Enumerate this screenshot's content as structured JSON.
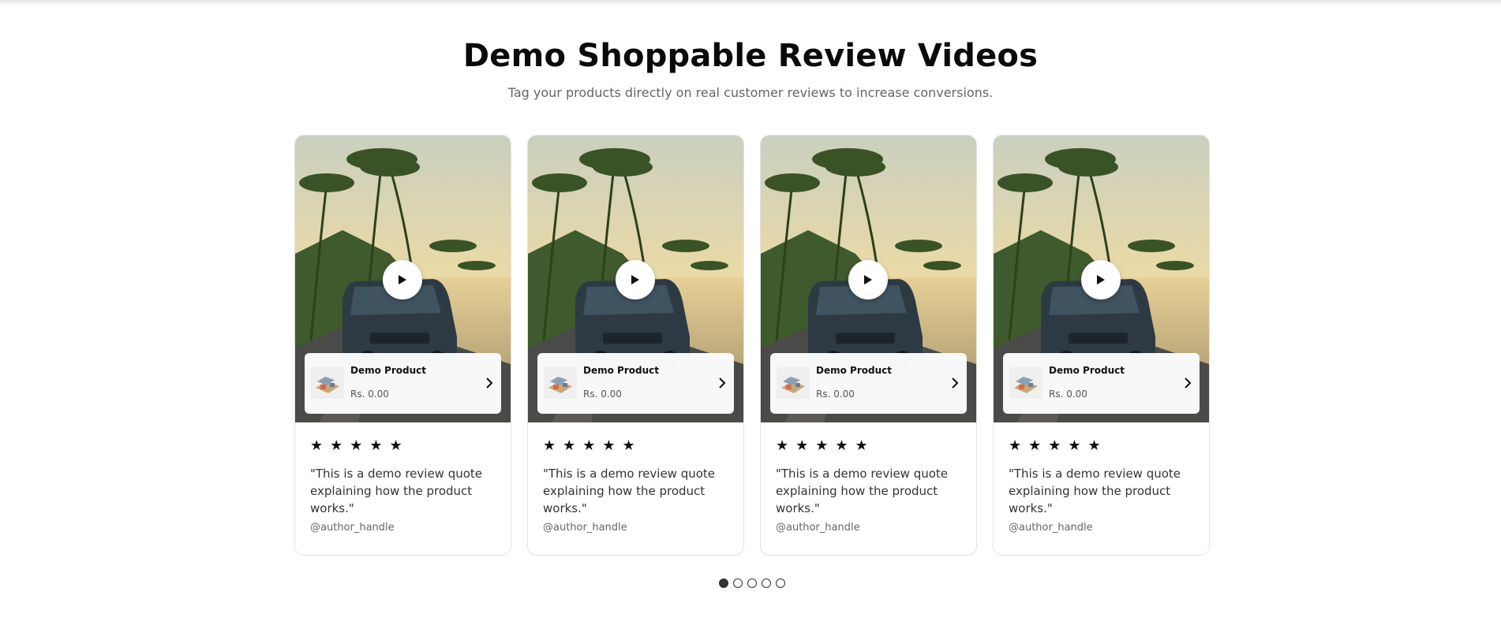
{
  "header": {
    "title": "Demo Shoppable Review Videos",
    "subtitle": "Tag your products directly on real customer reviews to increase conversions."
  },
  "cards": [
    {
      "product_name": "Demo Product",
      "price": "Rs. 0.00",
      "stars": "★★★★★",
      "rating": 5,
      "quote": "\"This is a demo review quote explaining how the product works.\"",
      "author": "@author_handle"
    },
    {
      "product_name": "Demo Product",
      "price": "Rs. 0.00",
      "stars": "★★★★★",
      "rating": 5,
      "quote": "\"This is a demo review quote explaining how the product works.\"",
      "author": "@author_handle"
    },
    {
      "product_name": "Demo Product",
      "price": "Rs. 0.00",
      "stars": "★★★★★",
      "rating": 5,
      "quote": "\"This is a demo review quote explaining how the product works.\"",
      "author": "@author_handle"
    },
    {
      "product_name": "Demo Product",
      "price": "Rs. 0.00",
      "stars": "★★★★★",
      "rating": 5,
      "quote": "\"This is a demo review quote explaining how the product works.\"",
      "author": "@author_handle"
    }
  ],
  "pagination": {
    "total": 5,
    "active": 1
  },
  "icons": {
    "play": "play-icon",
    "chevron": "chevron-right-icon"
  },
  "colors": {
    "text": "#111111",
    "muted": "#666666",
    "border": "#e3e3e3"
  }
}
